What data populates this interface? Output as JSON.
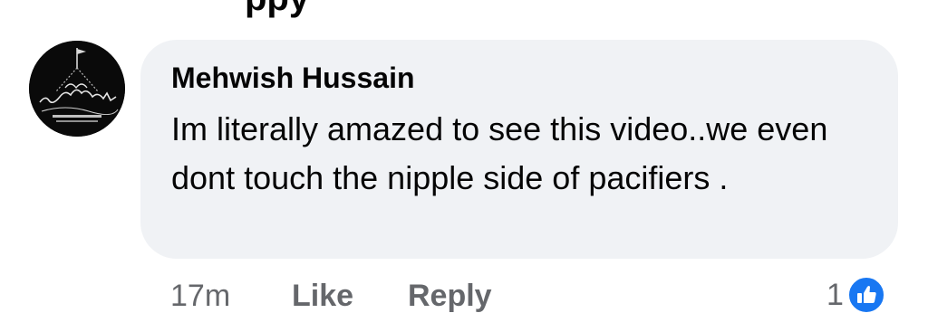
{
  "comment": {
    "author": "Mehwish Hussain",
    "text": "Im literally amazed to see this video..we even dont touch the nipple side of pacifiers .",
    "timestamp": "17m",
    "actions": {
      "like_label": "Like",
      "reply_label": "Reply"
    },
    "reactions": {
      "count": "1",
      "icon": "thumbs-up-icon",
      "color": "#1877f2"
    },
    "avatar_icon": "shrine-silhouette-avatar"
  },
  "colors": {
    "bubble_bg": "#f0f2f5",
    "text": "#050505",
    "secondary_text": "#65676b",
    "accent": "#1877f2"
  }
}
